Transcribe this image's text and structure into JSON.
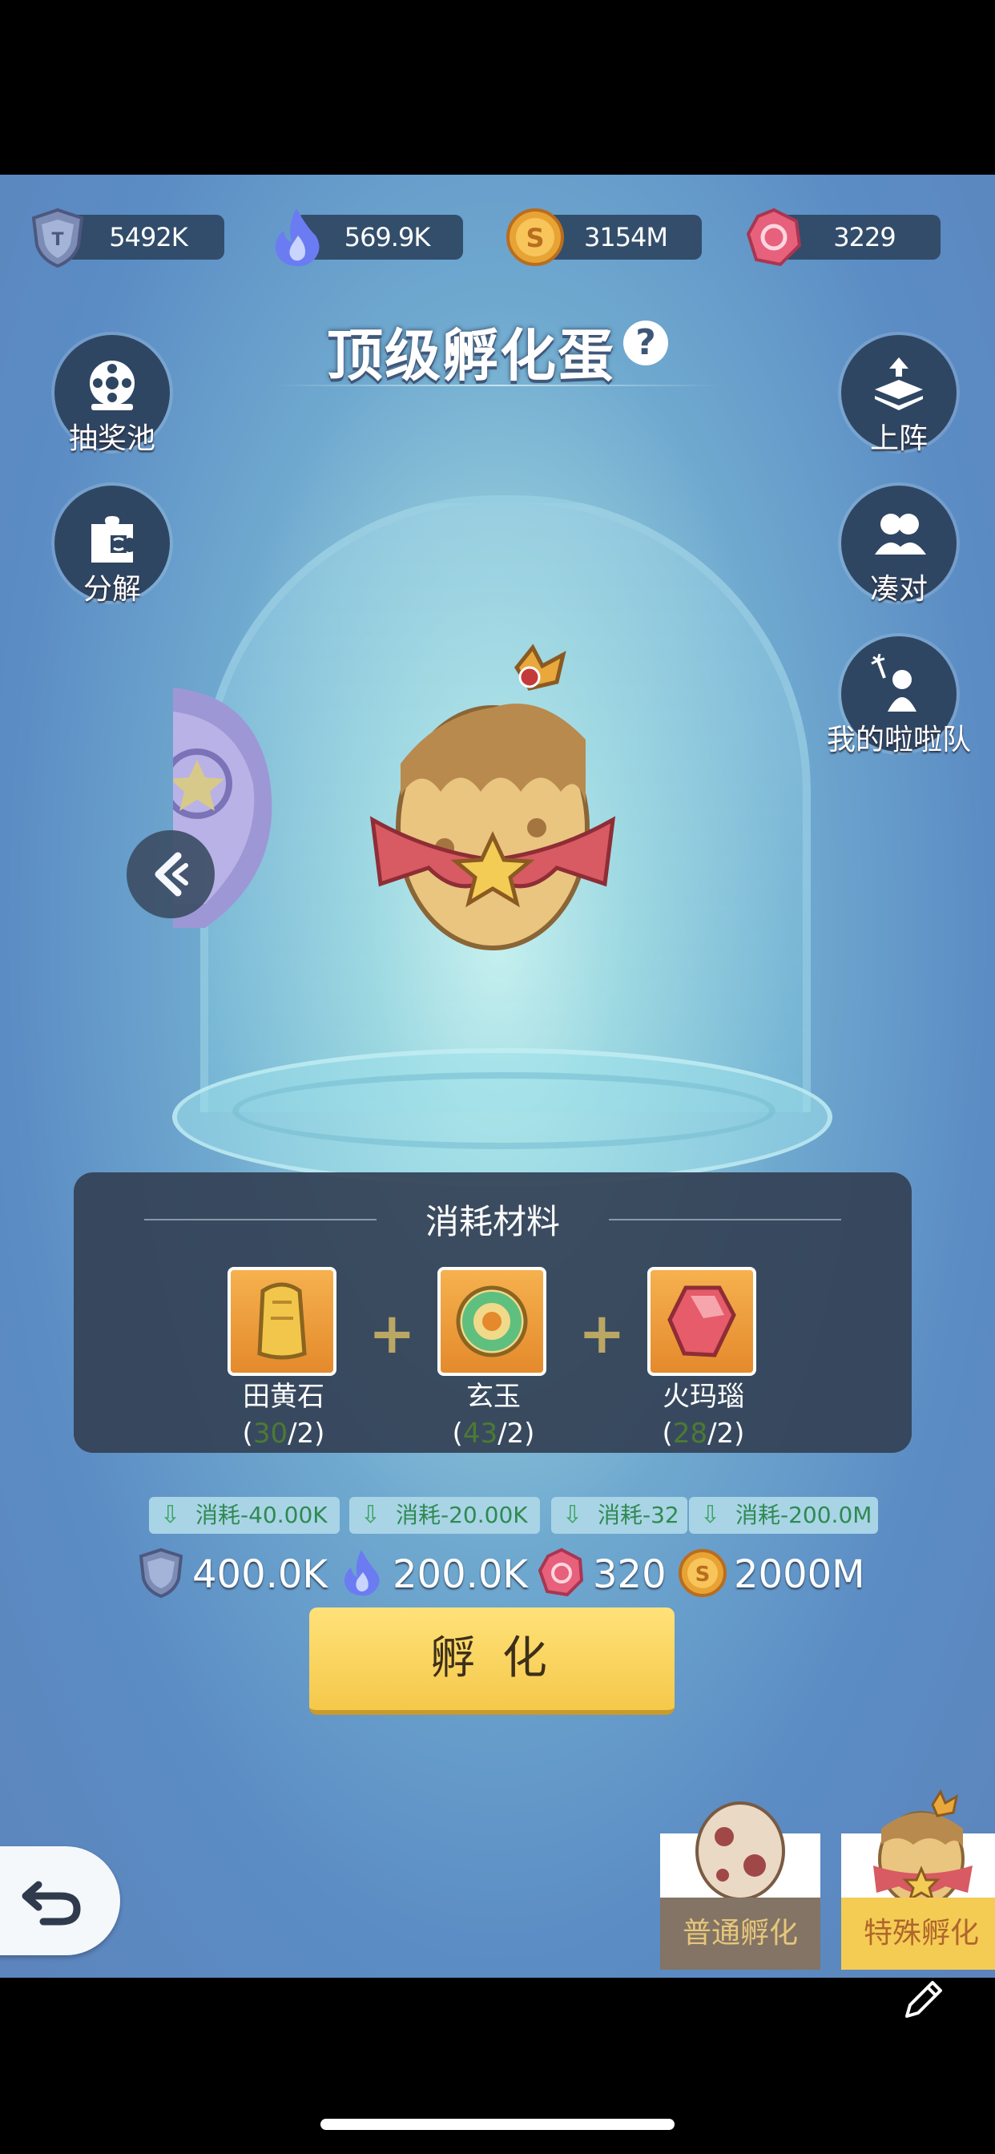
{
  "resources": [
    {
      "name": "shield",
      "value": "5492K"
    },
    {
      "name": "flame",
      "value": "569.9K"
    },
    {
      "name": "coin",
      "value": "3154M"
    },
    {
      "name": "gem",
      "value": "3229"
    }
  ],
  "header": {
    "title": "顶级孵化蛋",
    "help": "?"
  },
  "left_menu": [
    {
      "label": "抽奖池"
    },
    {
      "label": "分解"
    }
  ],
  "right_menu": [
    {
      "label": "上阵"
    },
    {
      "label": "凑对"
    },
    {
      "label": "我的啦啦队"
    }
  ],
  "materials_panel": {
    "title": "消耗材料",
    "items": [
      {
        "name": "田黄石",
        "have": "30",
        "need": "/2)"
      },
      {
        "name": "玄玉",
        "have": "43",
        "need": "/2)"
      },
      {
        "name": "火玛瑙",
        "have": "28",
        "need": "/2)"
      }
    ],
    "open_paren": "(",
    "plus": "+"
  },
  "discounts": [
    "消耗-40.00K",
    "消耗-20.00K",
    "消耗-32",
    "消耗-200.0M"
  ],
  "costs": [
    {
      "icon": "shield",
      "value": "400.0K"
    },
    {
      "icon": "flame",
      "value": "200.0K"
    },
    {
      "icon": "gem",
      "value": "320"
    },
    {
      "icon": "coin",
      "value": "2000M"
    }
  ],
  "hatch_button": "孵 化",
  "tabs": [
    {
      "label": "普通孵化",
      "selected": false
    },
    {
      "label": "特殊孵化",
      "selected": true
    }
  ],
  "colors": {
    "accent": "#f5c84a",
    "panel": "#344256",
    "discount_text": "#2f8a52"
  }
}
